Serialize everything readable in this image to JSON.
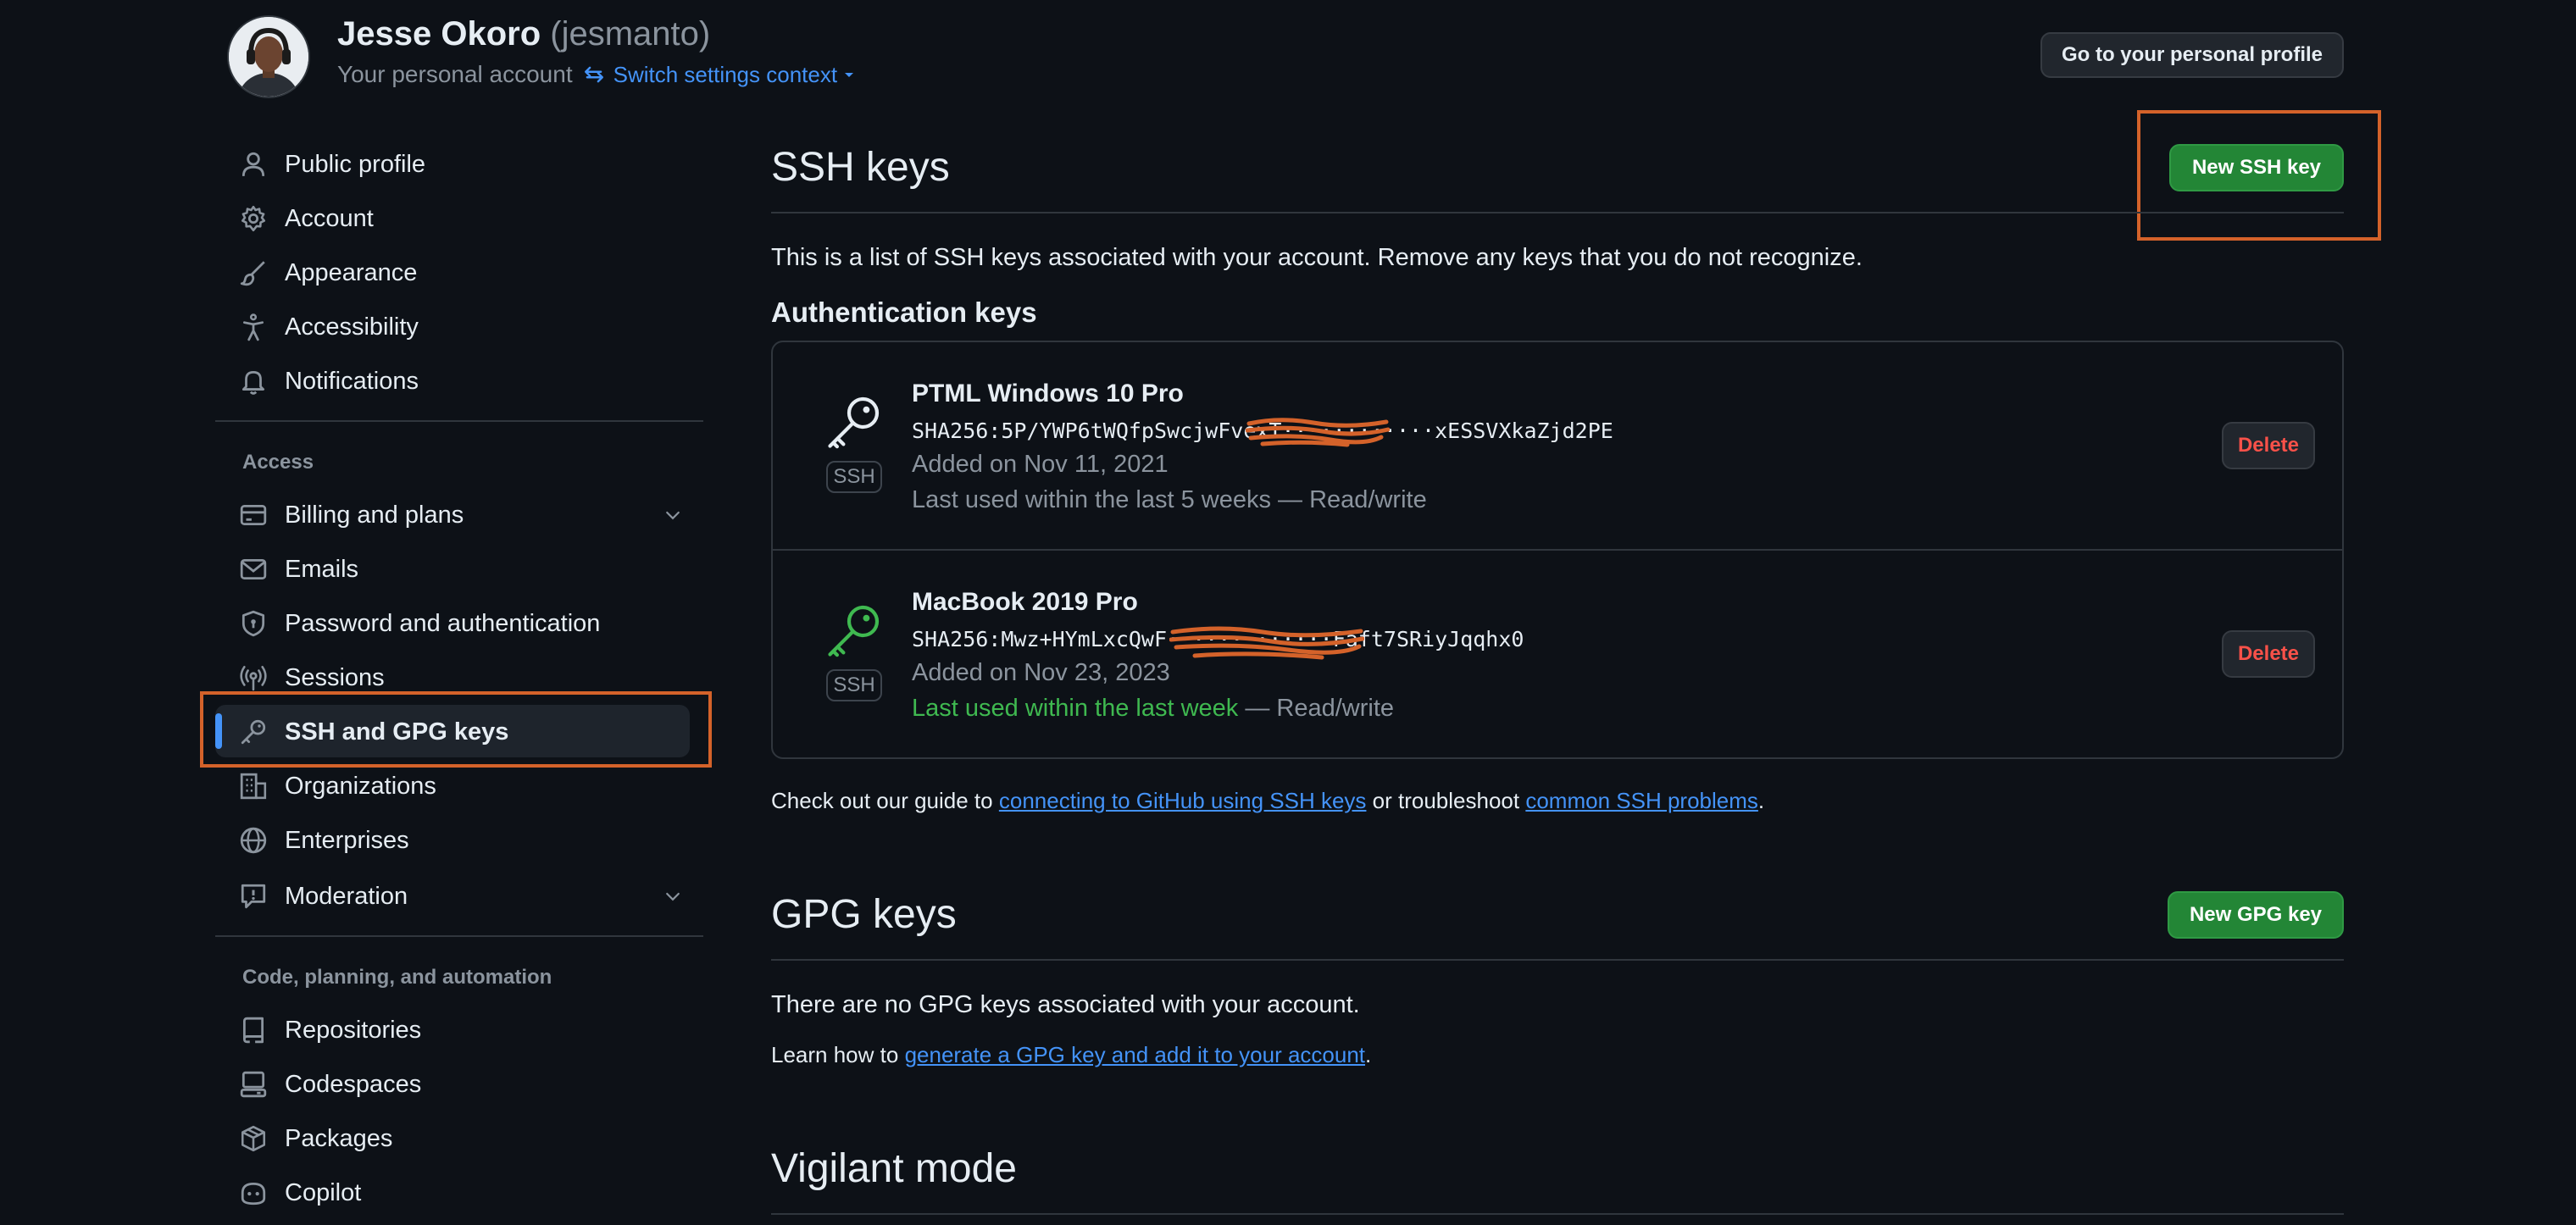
{
  "header": {
    "name": "Jesse Okoro",
    "handle": "(jesmanto)",
    "subtitle": "Your personal account",
    "switch_context": "Switch settings context",
    "profile_button": "Go to your personal profile"
  },
  "sidebar": {
    "top_items": [
      {
        "label": "Public profile",
        "icon": "person-icon"
      },
      {
        "label": "Account",
        "icon": "gear-icon"
      },
      {
        "label": "Appearance",
        "icon": "paintbrush-icon"
      },
      {
        "label": "Accessibility",
        "icon": "accessibility-icon"
      },
      {
        "label": "Notifications",
        "icon": "bell-icon"
      }
    ],
    "access_heading": "Access",
    "access_items": [
      {
        "label": "Billing and plans",
        "icon": "credit-card-icon"
      },
      {
        "label": "Emails",
        "icon": "mail-icon"
      },
      {
        "label": "Password and authentication",
        "icon": "shield-lock-icon"
      },
      {
        "label": "Sessions",
        "icon": "broadcast-icon"
      },
      {
        "label": "SSH and GPG keys",
        "icon": "key-icon",
        "active": true
      },
      {
        "label": "Organizations",
        "icon": "organization-icon"
      },
      {
        "label": "Enterprises",
        "icon": "globe-icon"
      },
      {
        "label": "Moderation",
        "icon": "report-icon"
      }
    ],
    "code_heading": "Code, planning, and automation",
    "code_items": [
      {
        "label": "Repositories",
        "icon": "repo-icon"
      },
      {
        "label": "Codespaces",
        "icon": "codespaces-icon"
      },
      {
        "label": "Packages",
        "icon": "package-icon"
      },
      {
        "label": "Copilot",
        "icon": "copilot-icon"
      }
    ]
  },
  "ssh": {
    "title": "SSH keys",
    "new_button": "New SSH key",
    "description": "This is a list of SSH keys associated with your account. Remove any keys that you do not recognize.",
    "auth_heading": "Authentication keys",
    "keys": [
      {
        "title": "PTML Windows 10 Pro",
        "fingerprint": "SHA256:5P/YWP6tWQfpSwcjwFvexT············xESSVXkaZjd2PE",
        "added": "Added on Nov 11, 2021",
        "last_used": "Last used within the last 5 weeks",
        "access": "— Read/write",
        "badge": "SSH",
        "delete_label": "Delete",
        "icon_color": "#e6edf3"
      },
      {
        "title": "MacBook 2019 Pro",
        "fingerprint": "SHA256:Mwz+HYmLxcQwF·············Faft7SRiyJqqhx0",
        "added": "Added on Nov 23, 2023",
        "last_used": "Last used within the last week",
        "access": "— Read/write",
        "badge": "SSH",
        "delete_label": "Delete",
        "icon_color": "#3fb950"
      }
    ],
    "guide_prefix": "Check out our guide to",
    "guide_link": "connecting to GitHub using SSH keys",
    "guide_middle": "or troubleshoot",
    "guide_link2": "common SSH problems",
    "guide_suffix": "."
  },
  "gpg": {
    "title": "GPG keys",
    "new_button": "New GPG key",
    "empty_text": "There are no GPG keys associated with your account.",
    "learn_prefix": "Learn how to",
    "learn_link": "generate a GPG key and add it to your account",
    "learn_suffix": "."
  },
  "vigilant": {
    "title": "Vigilant mode"
  },
  "colors": {
    "accent": "#4493f8",
    "green_button": "#238636",
    "danger": "#f85149",
    "annotation": "#d4622a",
    "background": "#0d1117"
  }
}
